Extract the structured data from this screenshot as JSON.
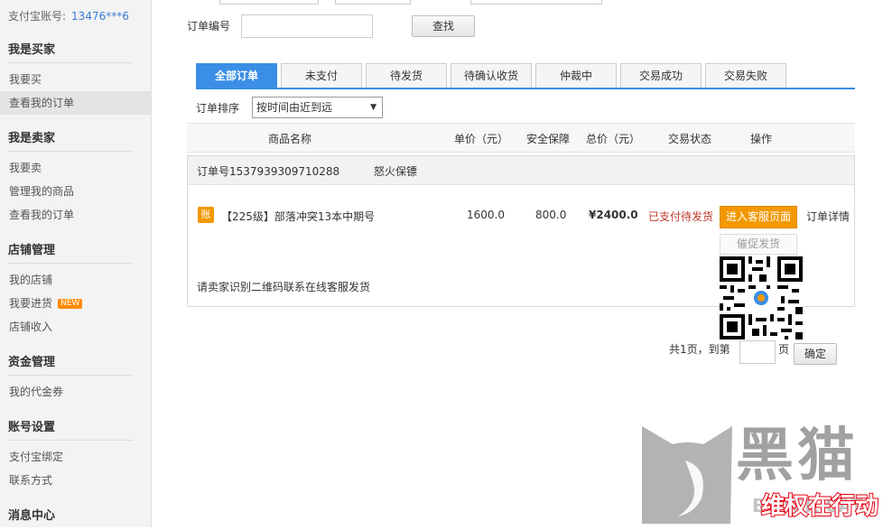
{
  "sidebar": {
    "account_label": "支付宝账号:",
    "account_value": "13476***6",
    "sections": [
      {
        "title": "我是买家",
        "items": [
          "我要买",
          "查看我的订单"
        ]
      },
      {
        "title": "我是卖家",
        "items": [
          "我要卖",
          "管理我的商品",
          "查看我的订单"
        ]
      },
      {
        "title": "店铺管理",
        "items": [
          "我的店铺",
          "我要进货",
          "店铺收入"
        ]
      },
      {
        "title": "资金管理",
        "items": [
          "我的代金券"
        ]
      },
      {
        "title": "账号设置",
        "items": [
          "支付宝绑定",
          "联系方式"
        ]
      },
      {
        "title": "消息中心",
        "items": []
      }
    ],
    "new_badge": "NEW"
  },
  "search": {
    "order_no_label": "订单编号",
    "order_no_value": "",
    "search_button": "查找"
  },
  "tabs": [
    "全部订单",
    "未支付",
    "待发货",
    "待确认收货",
    "仲裁中",
    "交易成功",
    "交易失败"
  ],
  "sort": {
    "label": "订单排序",
    "selected": "按时间由近到远"
  },
  "table_headers": {
    "name": "商品名称",
    "price": "单价（元）",
    "guarantee": "安全保障",
    "total": "总价（元）",
    "status": "交易状态",
    "action": "操作"
  },
  "order": {
    "order_no_label": "订单号",
    "order_no": "1537939309710288",
    "seller": "怒火保镖",
    "badge": "账",
    "item_name": "【225级】部落冲突13本中期号",
    "unit_price": "1600.0",
    "guarantee": "800.0",
    "total": "¥2400.0",
    "status": "已支付待发货",
    "cs_button": "进入客服页面",
    "detail_link": "订单详情",
    "urge_button": "催促发货",
    "note": "请卖家识别二维码联系在线客服发货"
  },
  "pager": {
    "total_pages_text": "共1页，到第",
    "page_value": "",
    "page_suffix": "页",
    "confirm": "确定"
  },
  "watermark": {
    "text": "黑猫",
    "subtext": "维权在行动",
    "brand": "BLACK CAT"
  },
  "colors": {
    "accent_blue": "#3a8ee6",
    "orange": "#f39800",
    "status_red": "#c0392b",
    "link_blue": "#3a7bd5"
  }
}
